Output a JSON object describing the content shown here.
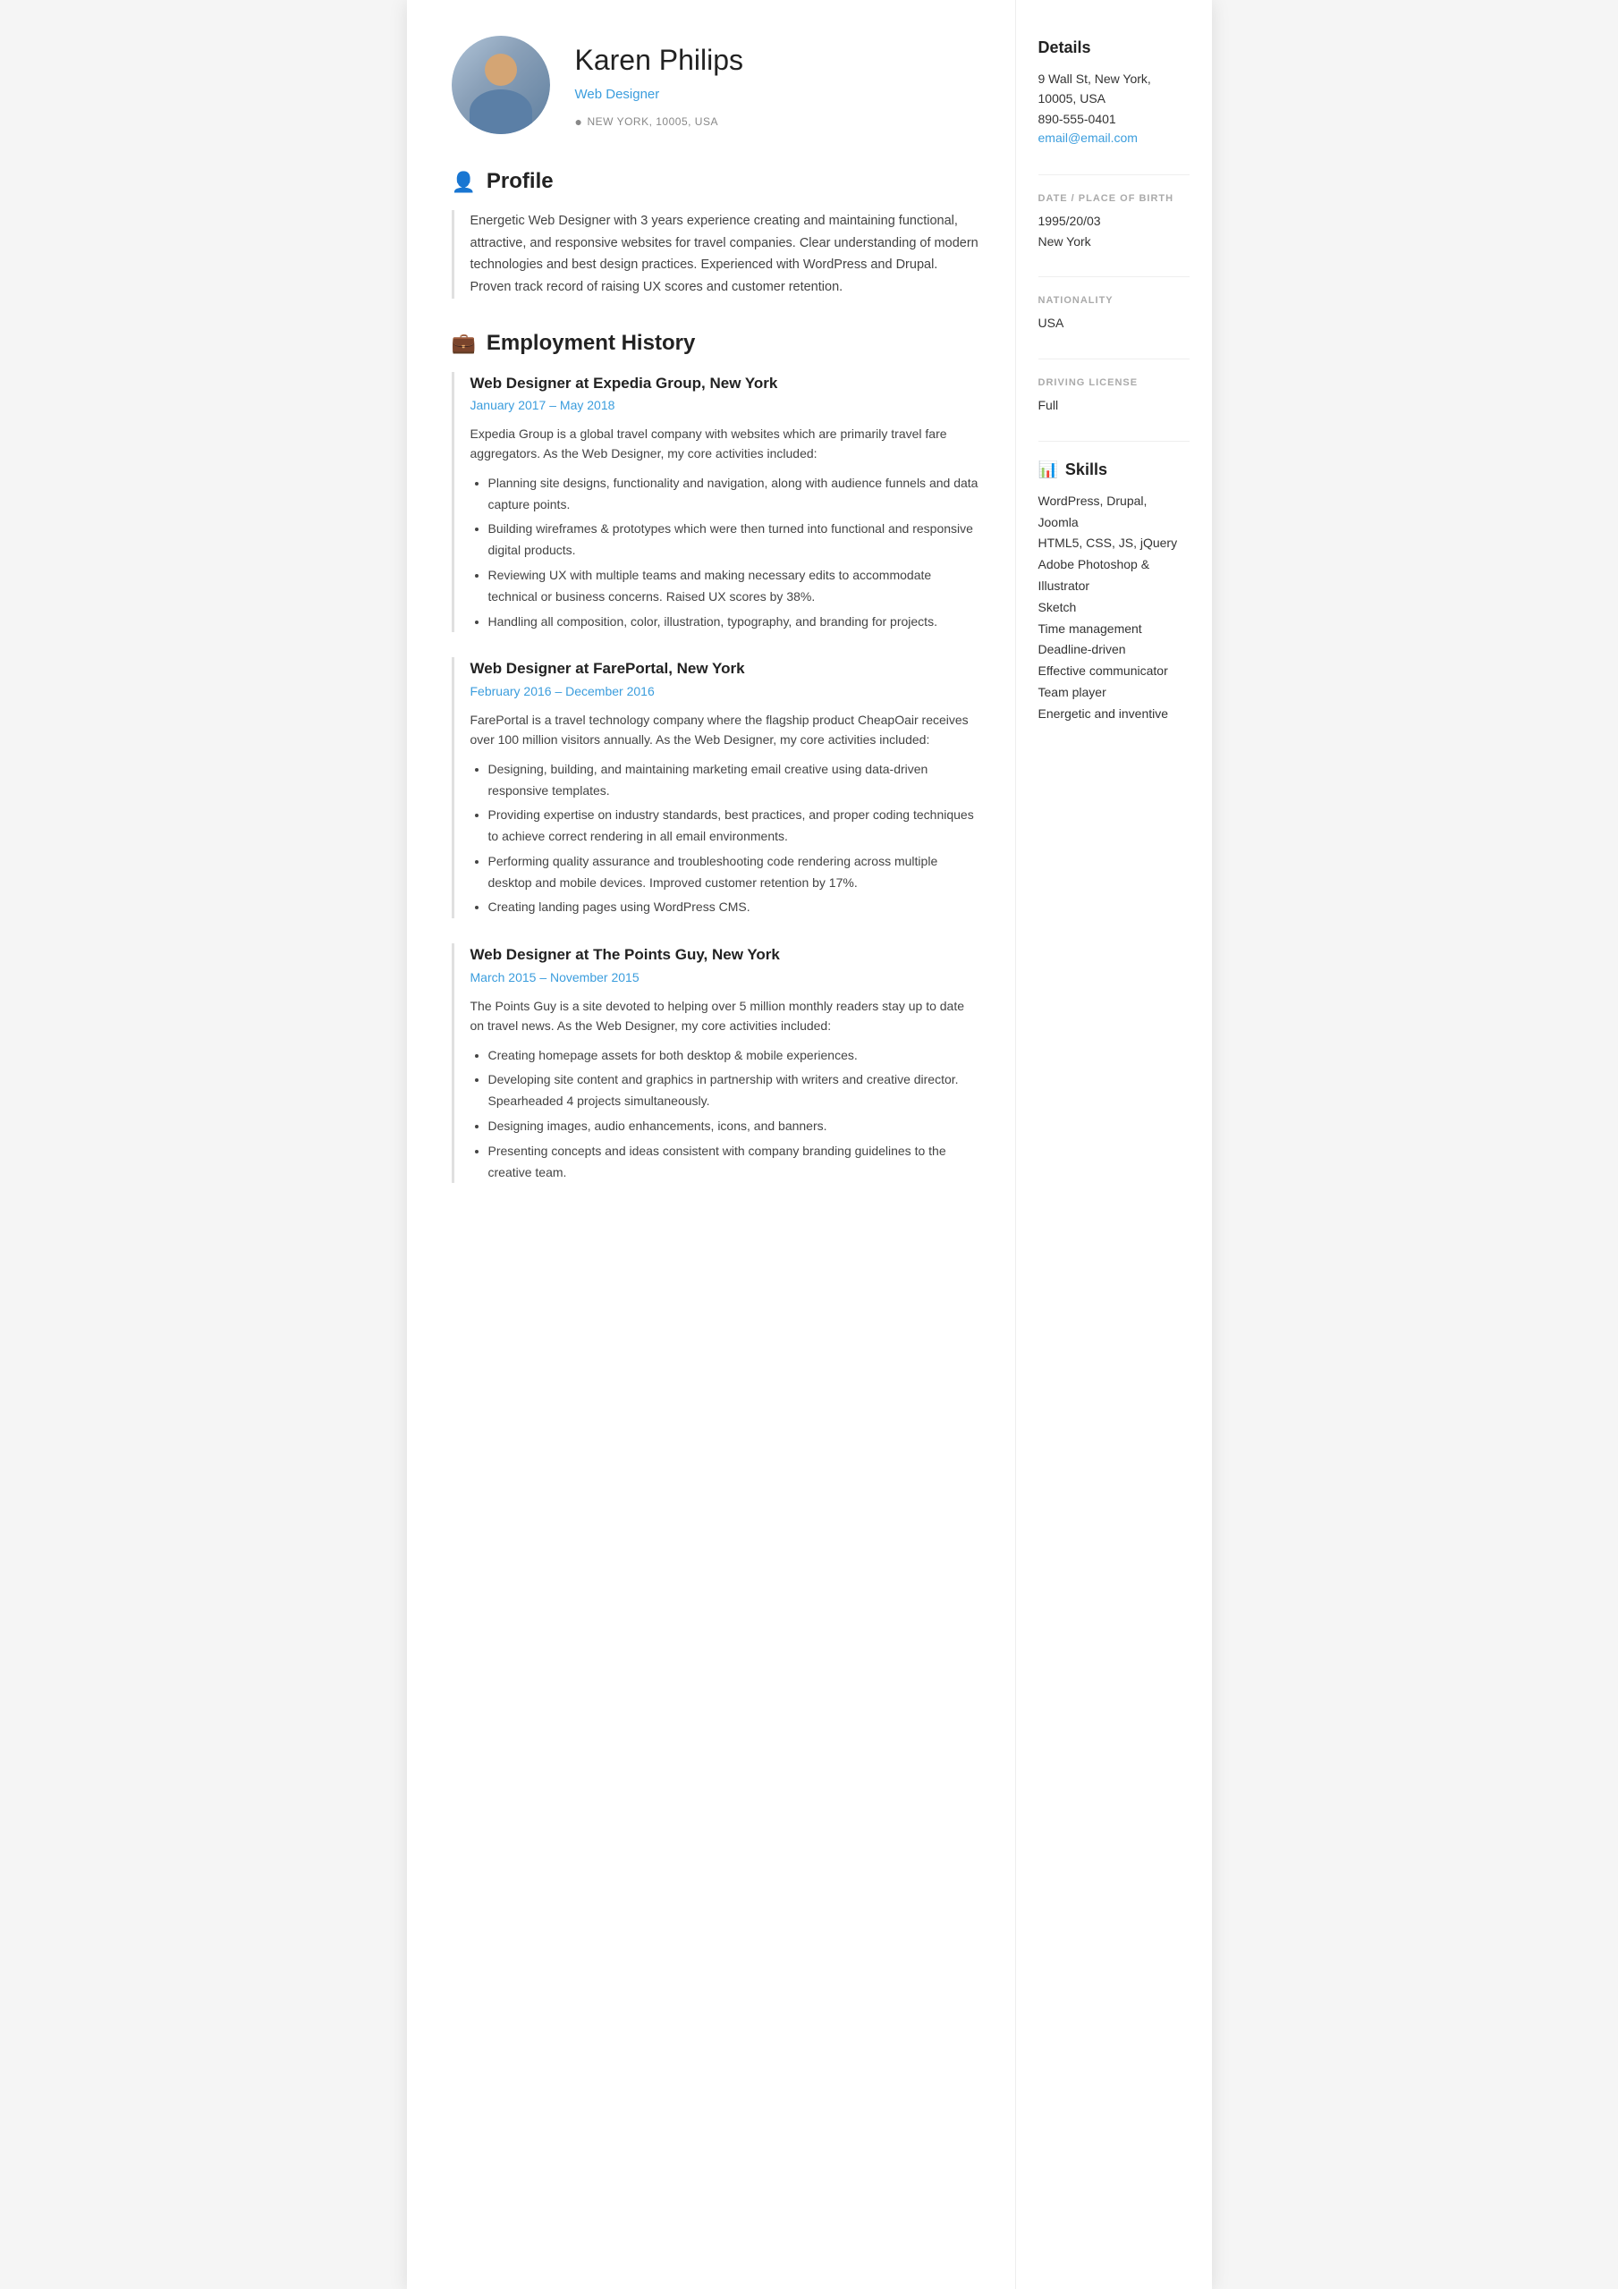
{
  "header": {
    "name": "Karen Philips",
    "title": "Web Designer",
    "location": "NEW YORK, 10005, USA"
  },
  "sidebar": {
    "details_title": "Details",
    "address": "9 Wall St, New York, 10005, USA",
    "phone": "890-555-0401",
    "email": "email@email.com",
    "dob_label": "DATE / PLACE OF BIRTH",
    "dob": "1995/20/03",
    "birth_place": "New York",
    "nationality_label": "NATIONALITY",
    "nationality": "USA",
    "driving_label": "DRIVING LICENSE",
    "driving": "Full",
    "skills_title": "Skills",
    "skills": [
      "WordPress, Drupal, Joomla",
      "HTML5, CSS, JS, jQuery",
      "Adobe Photoshop & Illustrator",
      "Sketch",
      "Time management",
      "Deadline-driven",
      "Effective communicator",
      "Team player",
      "Energetic and inventive"
    ]
  },
  "profile": {
    "section_title": "Profile",
    "text": "Energetic Web Designer with 3 years experience creating and maintaining functional, attractive, and responsive websites for travel companies. Clear understanding of modern technologies and best design practices. Experienced with WordPress and Drupal. Proven track record of raising UX scores and customer retention."
  },
  "employment": {
    "section_title": "Employment History",
    "jobs": [
      {
        "title": "Web Designer at Expedia Group, New York",
        "dates": "January 2017  –  May 2018",
        "description": "Expedia Group is a global travel company with websites which are primarily travel fare aggregators. As the Web Designer, my core activities included:",
        "bullets": [
          "Planning site designs, functionality and navigation, along with audience funnels and data capture points.",
          "Building wireframes & prototypes which were then turned into functional and responsive digital products.",
          "Reviewing UX with multiple teams and making necessary edits to accommodate technical or business concerns. Raised UX scores by 38%.",
          "Handling all composition, color, illustration, typography, and branding for projects."
        ]
      },
      {
        "title": "Web Designer at FarePortal, New York",
        "dates": "February 2016  –  December 2016",
        "description": "FarePortal is a travel technology company where the flagship product CheapOair receives over 100 million visitors annually. As the Web Designer, my core activities included:",
        "bullets": [
          "Designing, building, and maintaining marketing email creative using data-driven responsive templates.",
          "Providing expertise on industry standards, best practices, and proper coding techniques to achieve correct rendering in all email environments.",
          "Performing quality assurance and troubleshooting code rendering across multiple desktop and mobile devices. Improved customer retention by 17%.",
          "Creating landing pages using WordPress CMS."
        ]
      },
      {
        "title": "Web Designer at The Points Guy, New York",
        "dates": "March 2015  –  November 2015",
        "description": "The Points Guy is a site devoted to helping over 5 million monthly readers stay up to date on travel news. As the Web Designer, my core activities included:",
        "bullets": [
          "Creating homepage assets for both desktop & mobile experiences.",
          "Developing site content and graphics in partnership with writers and creative director. Spearheaded 4 projects simultaneously.",
          "Designing images, audio enhancements, icons, and banners.",
          "Presenting concepts and ideas consistent with company branding guidelines to the creative team."
        ]
      }
    ]
  }
}
